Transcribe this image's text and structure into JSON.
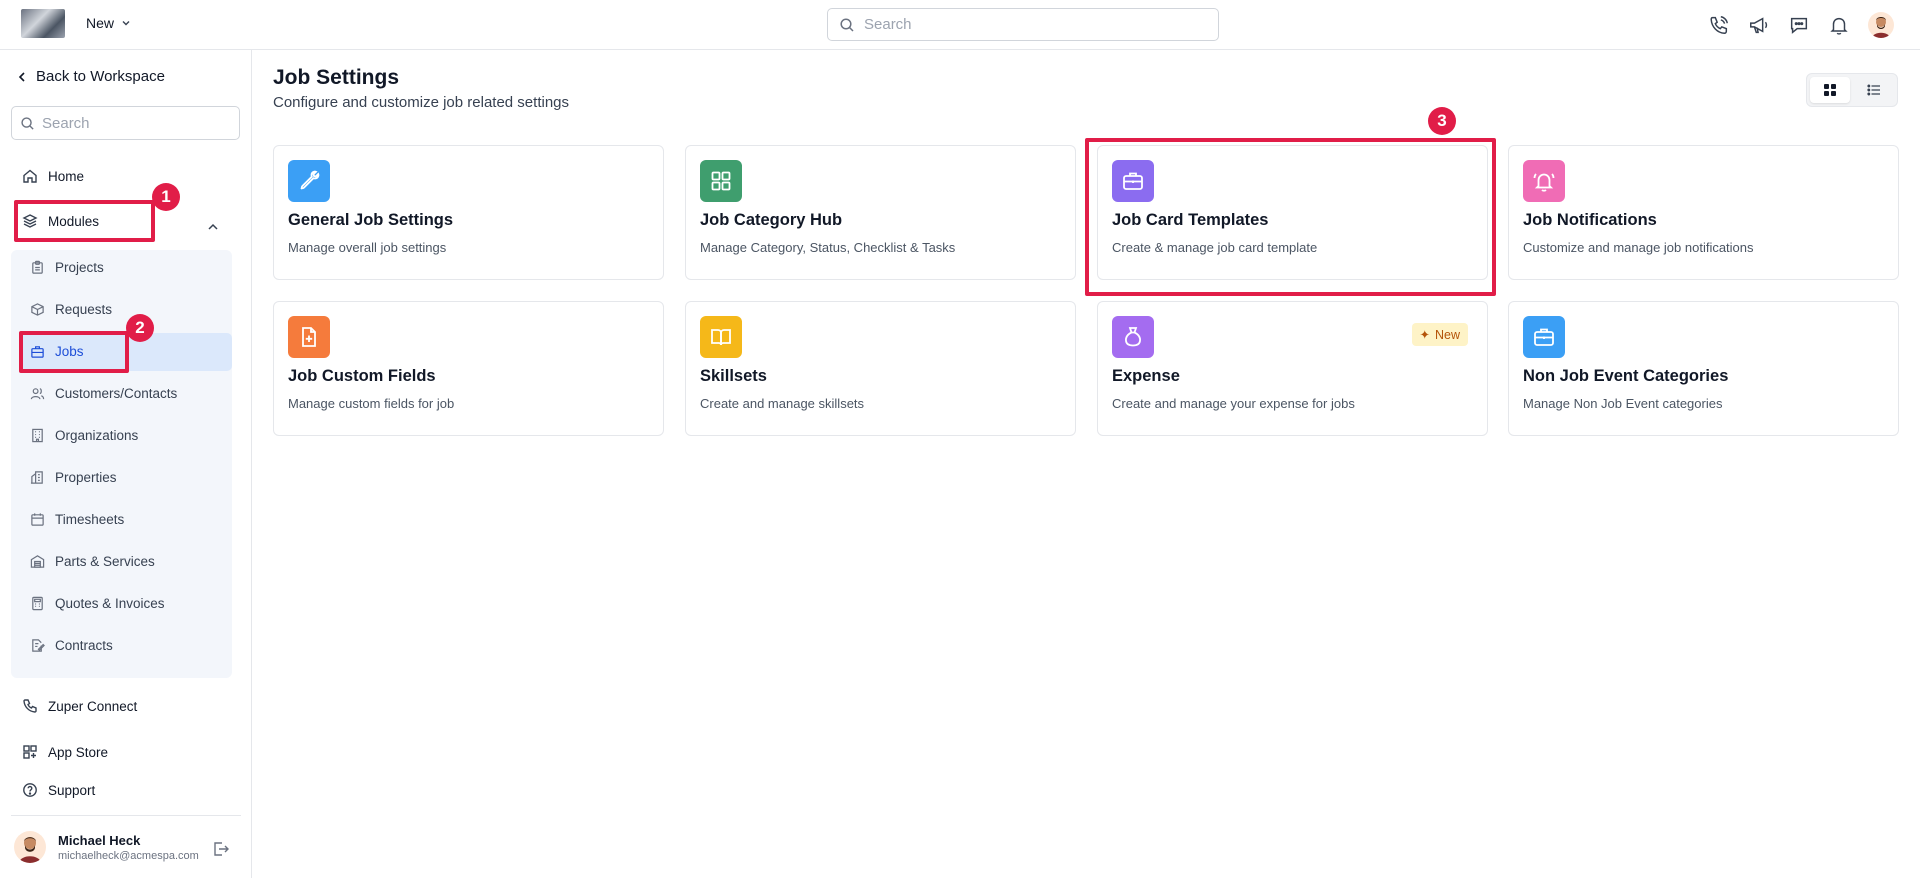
{
  "header": {
    "new_label": "New",
    "search_placeholder": "Search"
  },
  "sidebar": {
    "back_label": "Back to Workspace",
    "search_placeholder": "Search",
    "home": "Home",
    "modules": "Modules",
    "sub_items": [
      "Projects",
      "Requests",
      "Jobs",
      "Customers/Contacts",
      "Organizations",
      "Properties",
      "Timesheets",
      "Parts & Services",
      "Quotes & Invoices",
      "Contracts"
    ],
    "zuper_connect": "Zuper Connect",
    "app_store": "App Store",
    "support": "Support",
    "user": {
      "name": "Michael Heck",
      "email": "michaelheck@acmespa.com"
    }
  },
  "annotations": [
    "1",
    "2",
    "3"
  ],
  "main": {
    "title": "Job Settings",
    "subtitle": "Configure and customize job related settings",
    "cards": [
      {
        "title": "General Job Settings",
        "desc": "Manage overall job settings",
        "color": "#3b9ff5",
        "icon": "wrench-icon"
      },
      {
        "title": "Job Category Hub",
        "desc": "Manage Category, Status, Checklist & Tasks",
        "color": "#3f9e6e",
        "icon": "grid-icon"
      },
      {
        "title": "Job Card Templates",
        "desc": "Create & manage job card template",
        "color": "#8b6cf0",
        "icon": "briefcase-icon"
      },
      {
        "title": "Job Notifications",
        "desc": "Customize and manage job notifications",
        "color": "#f06cb5",
        "icon": "bell-ring-icon"
      },
      {
        "title": "Job Custom Fields",
        "desc": "Manage custom fields for job",
        "color": "#f57b3c",
        "icon": "file-plus-icon"
      },
      {
        "title": "Skillsets",
        "desc": "Create and manage skillsets",
        "color": "#f5b819",
        "icon": "book-open-icon"
      },
      {
        "title": "Expense",
        "desc": "Create and manage your expense for jobs",
        "color": "#a46cf0",
        "icon": "money-bag-icon",
        "badge": "New"
      },
      {
        "title": "Non Job Event Categories",
        "desc": "Manage Non Job Event categories",
        "color": "#3b9ff5",
        "icon": "briefcase-icon"
      }
    ]
  }
}
